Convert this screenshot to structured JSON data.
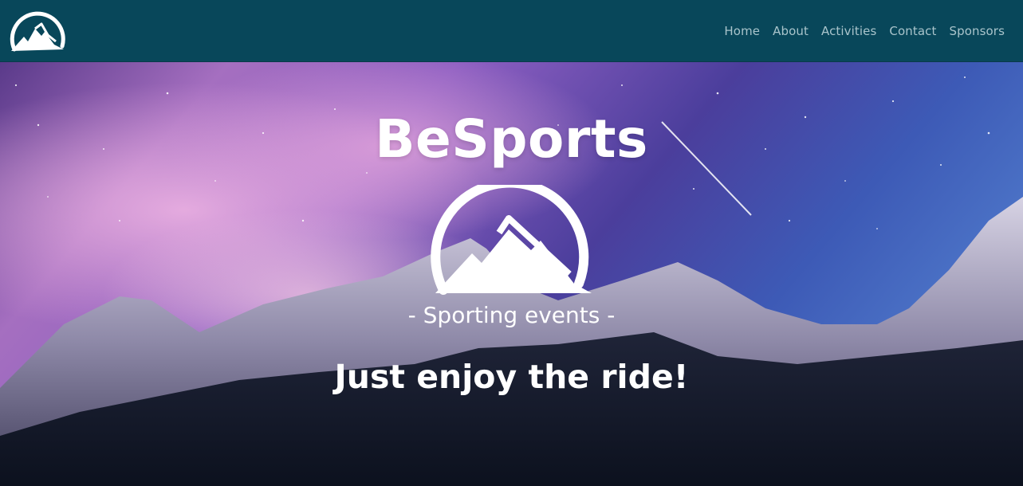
{
  "nav": {
    "logo_icon": "mountain-logo-icon",
    "links": [
      "Home",
      "About",
      "Activities",
      "Contact",
      "Sponsors"
    ],
    "background": "#08475a",
    "link_color": "#a9c4cb"
  },
  "hero": {
    "title": "BeSports",
    "emblem_icon": "mountain-emblem-icon",
    "subtitle": "- Sporting events -",
    "tagline": "Just enjoy the ride!",
    "background": "starry night sky over snowy mountains"
  }
}
